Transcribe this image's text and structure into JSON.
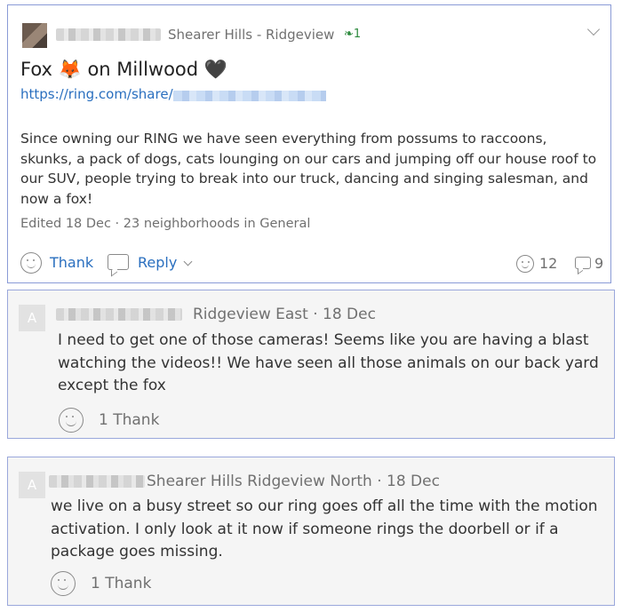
{
  "post": {
    "neighborhood": "Shearer Hills - Ridgeview",
    "thank_badge": "1",
    "title": "Fox 🦊 on Millwood 🖤",
    "link_prefix": "https://ring.com/share/",
    "body": "Since owning our RING we have seen everything from possums to raccoons, skunks, a pack of dogs, cats lounging on our cars and jumping off our house roof to our SUV, people trying to break into our truck, dancing and singing salesman, and now a fox!",
    "meta": "Edited 18 Dec · 23 neighborhoods in General",
    "thank_label": "Thank",
    "reply_label": "Reply",
    "thanks_count": "12",
    "replies_count": "9"
  },
  "comments": [
    {
      "avatar_letter": "A",
      "meta": "Ridgeview East · 18 Dec",
      "body": "I need to get one of those cameras! Seems like you are having a blast watching the videos!! We have seen all those animals on our back yard except the fox",
      "thanks": "1 Thank"
    },
    {
      "avatar_letter": "A",
      "meta": "Shearer Hills Ridgeview North · 18 Dec",
      "body": "we live on a busy street so our ring goes off all the time with the motion activation. I only look at it now if someone rings the doorbell or if a package goes missing.",
      "thanks": "1 Thank"
    }
  ],
  "icons": {
    "leaf": "leaf-icon",
    "chevron": "chevron-down-icon",
    "smile": "smiley-icon",
    "bubble": "speech-bubble-icon"
  },
  "colors": {
    "link": "#2a6fbf",
    "border": "#8a9bd6",
    "badge": "#2d8a3e"
  }
}
